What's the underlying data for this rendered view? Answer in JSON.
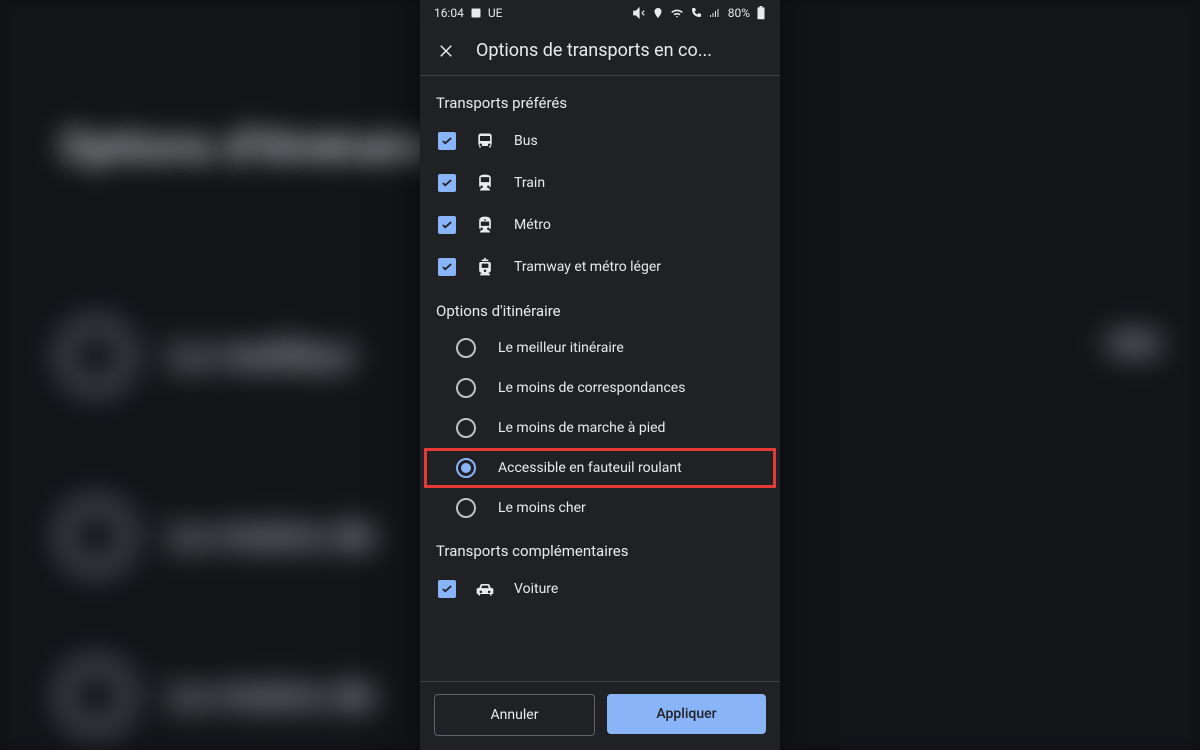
{
  "status": {
    "time": "16:04",
    "carrier": "UE",
    "battery": "80%"
  },
  "header": {
    "title": "Options de transports en co..."
  },
  "sections": {
    "preferred_title": "Transports préférés",
    "route_title": "Options d'itinéraire",
    "extra_title": "Transports complémentaires"
  },
  "preferred": [
    {
      "label": "Bus",
      "icon": "bus-icon",
      "checked": true
    },
    {
      "label": "Train",
      "icon": "train-icon",
      "checked": true
    },
    {
      "label": "Métro",
      "icon": "metro-icon",
      "checked": true
    },
    {
      "label": "Tramway et métro léger",
      "icon": "tram-icon",
      "checked": true
    }
  ],
  "routes": [
    {
      "label": "Le meilleur itinéraire",
      "selected": false
    },
    {
      "label": "Le moins de correspondances",
      "selected": false
    },
    {
      "label": "Le moins de marche à pied",
      "selected": false
    },
    {
      "label": "Accessible en fauteuil roulant",
      "selected": true,
      "highlight": true
    },
    {
      "label": "Le moins cher",
      "selected": false
    }
  ],
  "extra": [
    {
      "label": "Voiture",
      "icon": "car-icon",
      "checked": true
    }
  ],
  "footer": {
    "cancel": "Annuler",
    "apply": "Appliquer"
  },
  "colors": {
    "accent": "#8ab4f8",
    "highlight": "#e53935",
    "bg": "#202124"
  }
}
